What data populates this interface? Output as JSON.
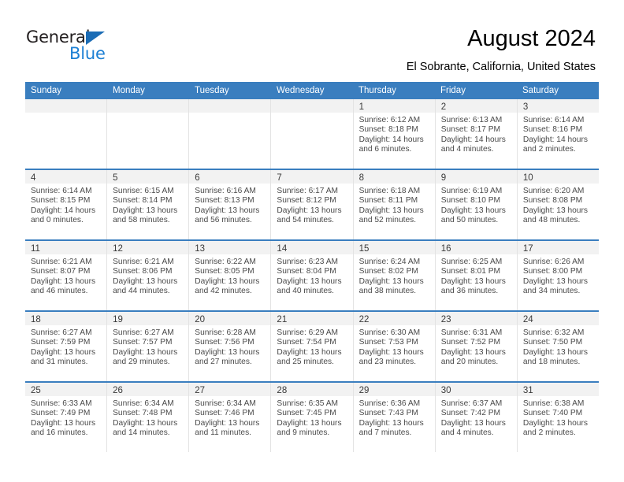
{
  "brand": {
    "name_top": "General",
    "name_bottom": "Blue",
    "accent_color": "#1b7fd4",
    "triangle_color": "#1b6cb5"
  },
  "header": {
    "title": "August 2024",
    "subtitle": "El Sobrante, California, United States"
  },
  "theme": {
    "header_row_bg": "#3a7ebf",
    "header_row_text": "#ffffff",
    "daynum_band_bg": "#f2f2f2",
    "cell_bg": "#ffffff",
    "week_divider": "#3a7ebf",
    "cell_divider": "#e3e3e3"
  },
  "calendar": {
    "weekday_headers": [
      "Sunday",
      "Monday",
      "Tuesday",
      "Wednesday",
      "Thursday",
      "Friday",
      "Saturday"
    ],
    "weeks": [
      [
        {
          "day": "",
          "empty": true
        },
        {
          "day": "",
          "empty": true
        },
        {
          "day": "",
          "empty": true
        },
        {
          "day": "",
          "empty": true
        },
        {
          "day": "1",
          "sunrise": "Sunrise: 6:12 AM",
          "sunset": "Sunset: 8:18 PM",
          "daylight1": "Daylight: 14 hours",
          "daylight2": "and 6 minutes."
        },
        {
          "day": "2",
          "sunrise": "Sunrise: 6:13 AM",
          "sunset": "Sunset: 8:17 PM",
          "daylight1": "Daylight: 14 hours",
          "daylight2": "and 4 minutes."
        },
        {
          "day": "3",
          "sunrise": "Sunrise: 6:14 AM",
          "sunset": "Sunset: 8:16 PM",
          "daylight1": "Daylight: 14 hours",
          "daylight2": "and 2 minutes."
        }
      ],
      [
        {
          "day": "4",
          "sunrise": "Sunrise: 6:14 AM",
          "sunset": "Sunset: 8:15 PM",
          "daylight1": "Daylight: 14 hours",
          "daylight2": "and 0 minutes."
        },
        {
          "day": "5",
          "sunrise": "Sunrise: 6:15 AM",
          "sunset": "Sunset: 8:14 PM",
          "daylight1": "Daylight: 13 hours",
          "daylight2": "and 58 minutes."
        },
        {
          "day": "6",
          "sunrise": "Sunrise: 6:16 AM",
          "sunset": "Sunset: 8:13 PM",
          "daylight1": "Daylight: 13 hours",
          "daylight2": "and 56 minutes."
        },
        {
          "day": "7",
          "sunrise": "Sunrise: 6:17 AM",
          "sunset": "Sunset: 8:12 PM",
          "daylight1": "Daylight: 13 hours",
          "daylight2": "and 54 minutes."
        },
        {
          "day": "8",
          "sunrise": "Sunrise: 6:18 AM",
          "sunset": "Sunset: 8:11 PM",
          "daylight1": "Daylight: 13 hours",
          "daylight2": "and 52 minutes."
        },
        {
          "day": "9",
          "sunrise": "Sunrise: 6:19 AM",
          "sunset": "Sunset: 8:10 PM",
          "daylight1": "Daylight: 13 hours",
          "daylight2": "and 50 minutes."
        },
        {
          "day": "10",
          "sunrise": "Sunrise: 6:20 AM",
          "sunset": "Sunset: 8:08 PM",
          "daylight1": "Daylight: 13 hours",
          "daylight2": "and 48 minutes."
        }
      ],
      [
        {
          "day": "11",
          "sunrise": "Sunrise: 6:21 AM",
          "sunset": "Sunset: 8:07 PM",
          "daylight1": "Daylight: 13 hours",
          "daylight2": "and 46 minutes."
        },
        {
          "day": "12",
          "sunrise": "Sunrise: 6:21 AM",
          "sunset": "Sunset: 8:06 PM",
          "daylight1": "Daylight: 13 hours",
          "daylight2": "and 44 minutes."
        },
        {
          "day": "13",
          "sunrise": "Sunrise: 6:22 AM",
          "sunset": "Sunset: 8:05 PM",
          "daylight1": "Daylight: 13 hours",
          "daylight2": "and 42 minutes."
        },
        {
          "day": "14",
          "sunrise": "Sunrise: 6:23 AM",
          "sunset": "Sunset: 8:04 PM",
          "daylight1": "Daylight: 13 hours",
          "daylight2": "and 40 minutes."
        },
        {
          "day": "15",
          "sunrise": "Sunrise: 6:24 AM",
          "sunset": "Sunset: 8:02 PM",
          "daylight1": "Daylight: 13 hours",
          "daylight2": "and 38 minutes."
        },
        {
          "day": "16",
          "sunrise": "Sunrise: 6:25 AM",
          "sunset": "Sunset: 8:01 PM",
          "daylight1": "Daylight: 13 hours",
          "daylight2": "and 36 minutes."
        },
        {
          "day": "17",
          "sunrise": "Sunrise: 6:26 AM",
          "sunset": "Sunset: 8:00 PM",
          "daylight1": "Daylight: 13 hours",
          "daylight2": "and 34 minutes."
        }
      ],
      [
        {
          "day": "18",
          "sunrise": "Sunrise: 6:27 AM",
          "sunset": "Sunset: 7:59 PM",
          "daylight1": "Daylight: 13 hours",
          "daylight2": "and 31 minutes."
        },
        {
          "day": "19",
          "sunrise": "Sunrise: 6:27 AM",
          "sunset": "Sunset: 7:57 PM",
          "daylight1": "Daylight: 13 hours",
          "daylight2": "and 29 minutes."
        },
        {
          "day": "20",
          "sunrise": "Sunrise: 6:28 AM",
          "sunset": "Sunset: 7:56 PM",
          "daylight1": "Daylight: 13 hours",
          "daylight2": "and 27 minutes."
        },
        {
          "day": "21",
          "sunrise": "Sunrise: 6:29 AM",
          "sunset": "Sunset: 7:54 PM",
          "daylight1": "Daylight: 13 hours",
          "daylight2": "and 25 minutes."
        },
        {
          "day": "22",
          "sunrise": "Sunrise: 6:30 AM",
          "sunset": "Sunset: 7:53 PM",
          "daylight1": "Daylight: 13 hours",
          "daylight2": "and 23 minutes."
        },
        {
          "day": "23",
          "sunrise": "Sunrise: 6:31 AM",
          "sunset": "Sunset: 7:52 PM",
          "daylight1": "Daylight: 13 hours",
          "daylight2": "and 20 minutes."
        },
        {
          "day": "24",
          "sunrise": "Sunrise: 6:32 AM",
          "sunset": "Sunset: 7:50 PM",
          "daylight1": "Daylight: 13 hours",
          "daylight2": "and 18 minutes."
        }
      ],
      [
        {
          "day": "25",
          "sunrise": "Sunrise: 6:33 AM",
          "sunset": "Sunset: 7:49 PM",
          "daylight1": "Daylight: 13 hours",
          "daylight2": "and 16 minutes."
        },
        {
          "day": "26",
          "sunrise": "Sunrise: 6:34 AM",
          "sunset": "Sunset: 7:48 PM",
          "daylight1": "Daylight: 13 hours",
          "daylight2": "and 14 minutes."
        },
        {
          "day": "27",
          "sunrise": "Sunrise: 6:34 AM",
          "sunset": "Sunset: 7:46 PM",
          "daylight1": "Daylight: 13 hours",
          "daylight2": "and 11 minutes."
        },
        {
          "day": "28",
          "sunrise": "Sunrise: 6:35 AM",
          "sunset": "Sunset: 7:45 PM",
          "daylight1": "Daylight: 13 hours",
          "daylight2": "and 9 minutes."
        },
        {
          "day": "29",
          "sunrise": "Sunrise: 6:36 AM",
          "sunset": "Sunset: 7:43 PM",
          "daylight1": "Daylight: 13 hours",
          "daylight2": "and 7 minutes."
        },
        {
          "day": "30",
          "sunrise": "Sunrise: 6:37 AM",
          "sunset": "Sunset: 7:42 PM",
          "daylight1": "Daylight: 13 hours",
          "daylight2": "and 4 minutes."
        },
        {
          "day": "31",
          "sunrise": "Sunrise: 6:38 AM",
          "sunset": "Sunset: 7:40 PM",
          "daylight1": "Daylight: 13 hours",
          "daylight2": "and 2 minutes."
        }
      ]
    ]
  }
}
